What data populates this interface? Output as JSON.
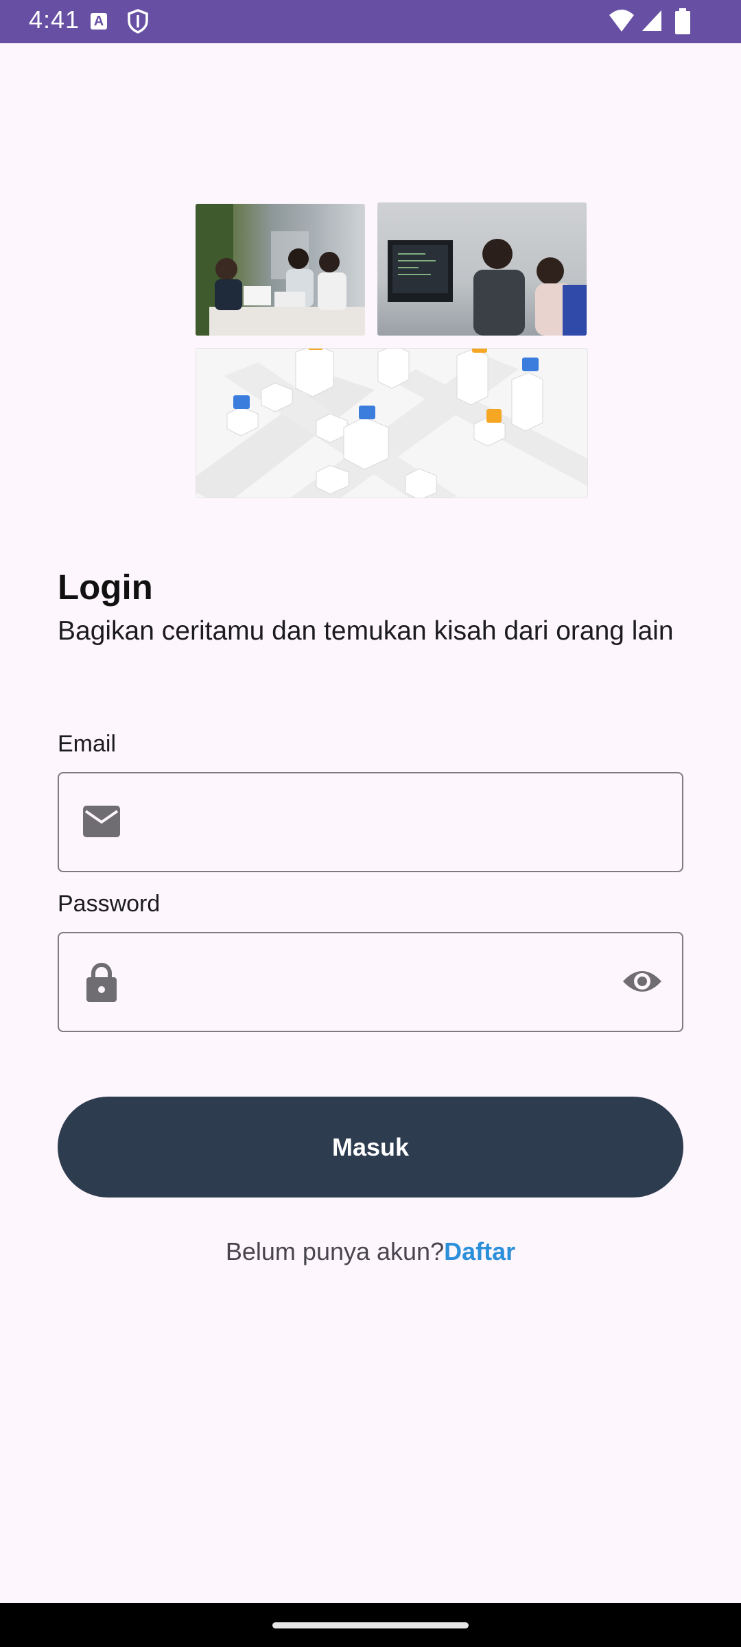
{
  "status_bar": {
    "time": "4:41",
    "notification_icon_letter": "A",
    "icons": [
      "a-notification-icon",
      "shield-icon",
      "wifi-icon",
      "signal-icon",
      "battery-icon"
    ]
  },
  "hero": {
    "icons": [
      "meeting-photo",
      "presentation-photo",
      "isometric-city-map"
    ]
  },
  "login": {
    "title": "Login",
    "subtitle": "Bagikan ceritamu dan temukan kisah dari orang lain"
  },
  "email": {
    "label": "Email",
    "value": "",
    "placeholder": "",
    "icon": "mail-icon"
  },
  "password": {
    "label": "Password",
    "value": "",
    "placeholder": "",
    "icon": "lock-icon",
    "toggle_icon": "eye-icon"
  },
  "submit": {
    "label": "Masuk"
  },
  "register": {
    "prompt": "Belum punya akun?",
    "link": "Daftar"
  },
  "colors": {
    "status_bar": "#6750a4",
    "background": "#fdf6fc",
    "button": "#2e3c50",
    "link": "#2b90d9",
    "pin_orange": "#f5a623",
    "pin_blue": "#3b7ddd"
  }
}
